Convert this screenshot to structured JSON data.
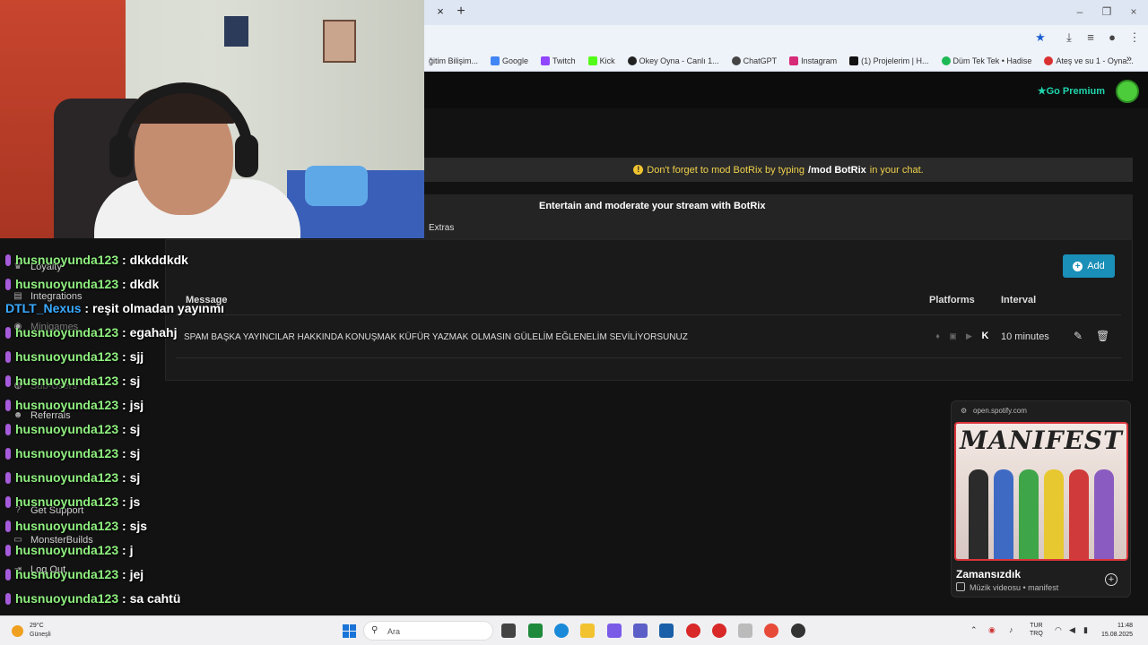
{
  "browser": {
    "tab_close": "×",
    "tab_new": "+",
    "window": {
      "minimize": "–",
      "restore": "❐",
      "close": "×"
    },
    "bookmarks": [
      {
        "label": "ğitim Bilişim...",
        "color": "#3b6fd8"
      },
      {
        "label": "Google",
        "color": "#4285f4"
      },
      {
        "label": "Twitch",
        "color": "#9146ff"
      },
      {
        "label": "Kick",
        "color": "#53fc18"
      },
      {
        "label": "Okey Oyna - Canlı 1...",
        "color": "#222222"
      },
      {
        "label": "ChatGPT",
        "color": "#444444"
      },
      {
        "label": "Instagram",
        "color": "#d62976"
      },
      {
        "label": "(1) Projelerim | H...",
        "color": "#111111"
      },
      {
        "label": "Düm Tek Tek • Hadise",
        "color": "#1db954"
      },
      {
        "label": "Ateş ve su 1 - Oyna...",
        "color": "#d93030"
      }
    ],
    "bookmarks_more": "»"
  },
  "page": {
    "premium_label": "Go Premium",
    "notice_prefix": "Don't forget to mod BotRix by typing",
    "notice_cmd": "/mod BotRix",
    "notice_suffix": "in your chat.",
    "entertain_title": "Entertain and moderate your stream with BotRix",
    "extras_tab": "Extras",
    "add_label": "Add",
    "col_message": "Message",
    "col_platforms": "Platforms",
    "col_interval": "Interval",
    "row": {
      "message": "SPAM BAŞKA YAYINCILAR HAKKINDA KONUŞMAK KÜFÜR YAZMAK OLMASIN GÜLELİM EĞLENELİM SEVİLİYORSUNUZ",
      "interval": "10 minutes"
    }
  },
  "sidebar": [
    {
      "label": "Loyalty",
      "icon": "trophy-icon"
    },
    {
      "label": "Integrations",
      "icon": "plug-icon"
    },
    {
      "label": "Minigames",
      "icon": "gamepad-icon"
    },
    {
      "label": "Sub-Users",
      "icon": "users-icon"
    },
    {
      "label": "Referrals",
      "icon": "referral-icon"
    },
    {
      "label": "Get Support",
      "icon": "help-icon"
    },
    {
      "label": "MonsterBuilds",
      "icon": "monitor-icon"
    },
    {
      "label": "Log Out",
      "icon": "logout-icon"
    }
  ],
  "chat": [
    {
      "user": "husnuoyunda123",
      "text": "dkkddkdk"
    },
    {
      "user": "husnuoyunda123",
      "text": "dkdk"
    },
    {
      "user": "DTLT_Nexus",
      "text": "reşit olmadan yayınmı",
      "alt": true
    },
    {
      "user": "husnuoyunda123",
      "text": "egahahj"
    },
    {
      "user": "husnuoyunda123",
      "text": "sjj"
    },
    {
      "user": "husnuoyunda123",
      "text": "sj"
    },
    {
      "user": "husnuoyunda123",
      "text": "jsj"
    },
    {
      "user": "husnuoyunda123",
      "text": "sj"
    },
    {
      "user": "husnuoyunda123",
      "text": "sj"
    },
    {
      "user": "husnuoyunda123",
      "text": "sj"
    },
    {
      "user": "husnuoyunda123",
      "text": "js"
    },
    {
      "user": "husnuoyunda123",
      "text": "sjs"
    },
    {
      "user": "husnuoyunda123",
      "text": "j"
    },
    {
      "user": "husnuoyunda123",
      "text": "jej"
    },
    {
      "user": "husnuoyunda123",
      "text": "sa cahtü"
    }
  ],
  "spotify": {
    "url": "open.spotify.com",
    "cover_text": "MANIFEST",
    "song": "Zamansızdık",
    "artist": "Müzik videosu • manifest"
  },
  "taskbar": {
    "temp": "29°C",
    "condition": "Güneşli",
    "search_placeholder": "Ara",
    "lang_top": "TUR",
    "lang_bottom": "TRQ",
    "time": "11:48",
    "date": "15.08.2025"
  }
}
